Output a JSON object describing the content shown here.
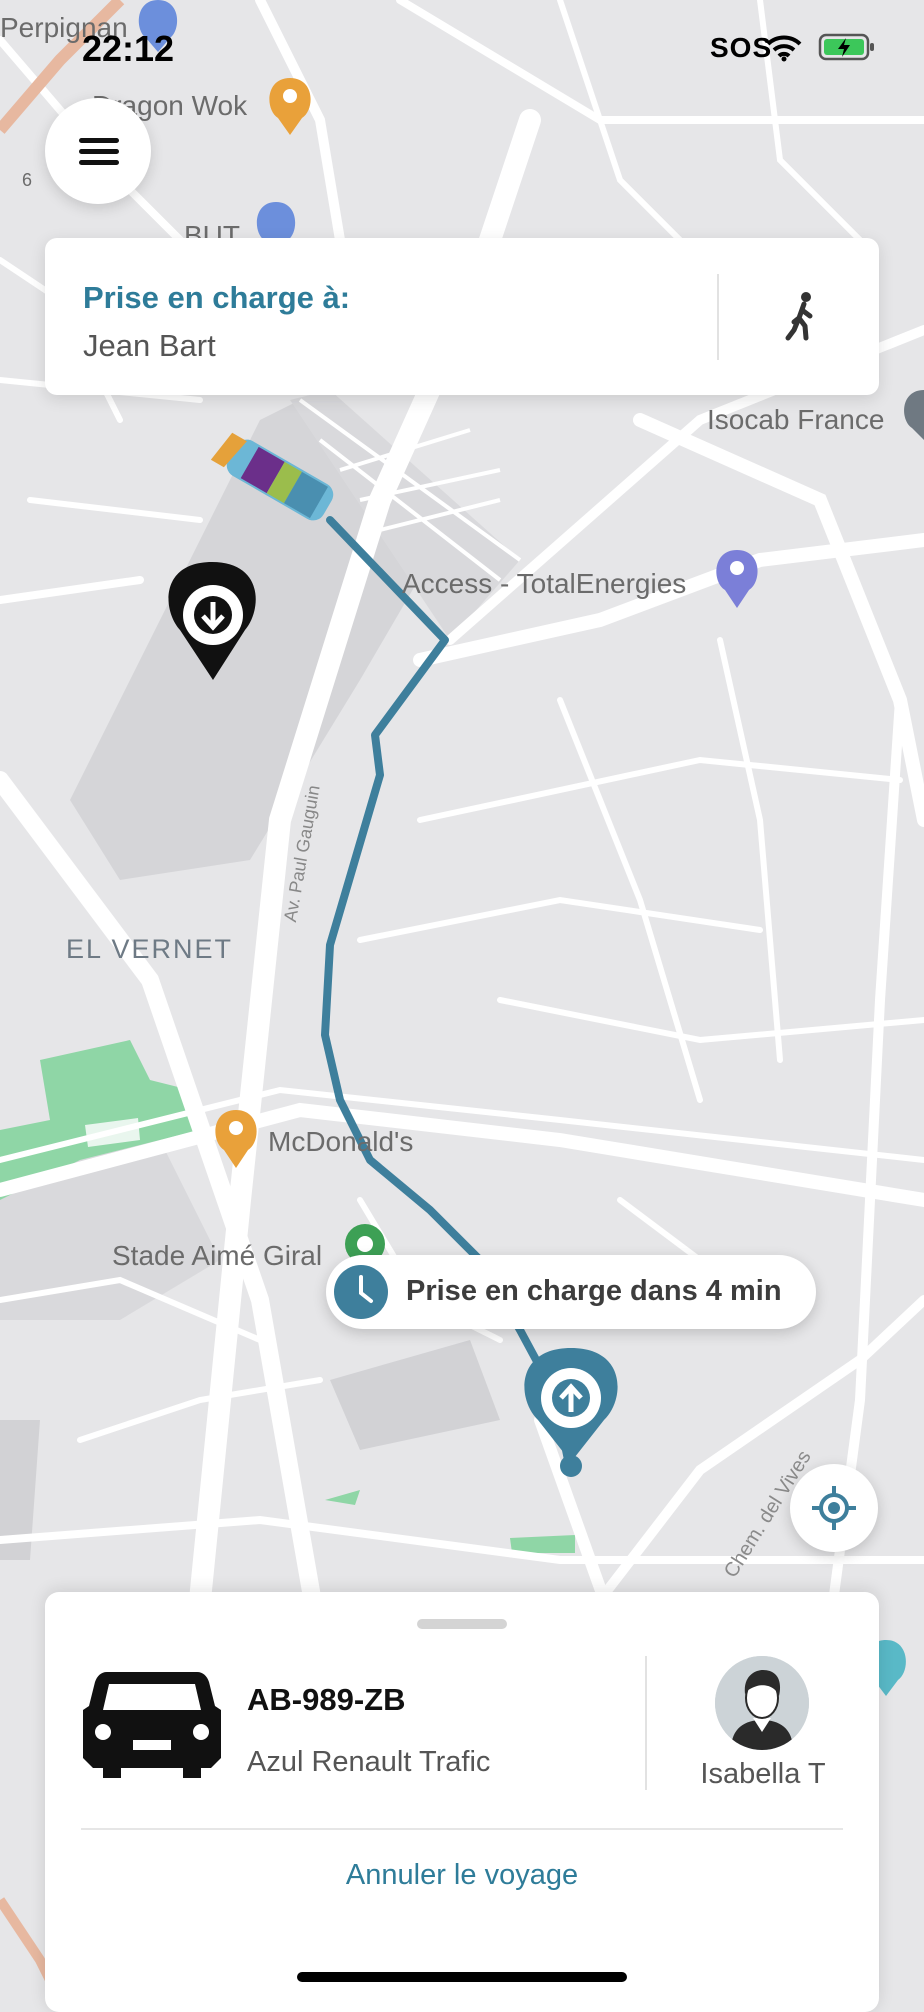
{
  "status_bar": {
    "time": "22:12",
    "sos": "SOS"
  },
  "map": {
    "labels": {
      "perpignan": "Perpignan",
      "dragon_wok": "Dragon Wok",
      "but": "BUT",
      "isocab": "Isocab France",
      "totalenergies": "Access - TotalEnergies",
      "el_vernet": "EL VERNET",
      "street": "Av. Paul Gauguin",
      "mcdonalds": "McDonald's",
      "stade": "Stade Aimé Giral",
      "chem": "Chem. del Vives",
      "six": "6"
    }
  },
  "pickup_card": {
    "title": "Prise en charge à:",
    "place": "Jean Bart"
  },
  "eta": {
    "text": "Prise en charge dans 4 min"
  },
  "ride": {
    "plate": "AB-989-ZB",
    "vehicle": "Azul Renault Trafic",
    "driver": "Isabella T",
    "cancel": "Annuler le voyage"
  },
  "icons": [
    "menu-icon",
    "walk-icon",
    "clock-icon",
    "locate-icon",
    "car-icon",
    "avatar",
    "wifi-icon",
    "battery-icon",
    "pin-icon"
  ],
  "colors": {
    "accent": "#2e7c99",
    "route": "#3e7f9c",
    "park": "#8fd6a6",
    "map_bg": "#e6e6e8"
  }
}
